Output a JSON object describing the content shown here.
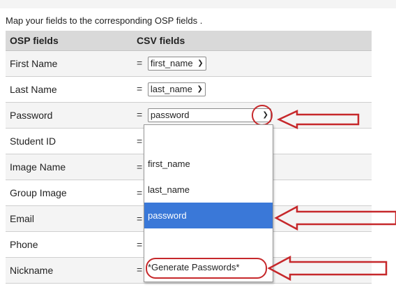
{
  "intro_text": "Map your fields to the corresponding OSP fields .",
  "headers": {
    "osp": "OSP fields",
    "csv": "CSV fields"
  },
  "rows": [
    {
      "label": "First Name",
      "value": "first_name"
    },
    {
      "label": "Last Name",
      "value": "last_name"
    },
    {
      "label": "Password",
      "value": "password"
    },
    {
      "label": "Student ID",
      "value": ""
    },
    {
      "label": "Image Name",
      "value": ""
    },
    {
      "label": "Group Image",
      "value": ""
    },
    {
      "label": "Email",
      "value": ""
    },
    {
      "label": "Phone",
      "value": ""
    },
    {
      "label": "Nickname",
      "value": ""
    }
  ],
  "equals": "=",
  "dropdown_options": [
    "",
    "first_name",
    "last_name",
    "password",
    "",
    "*Generate Passwords*"
  ],
  "dropdown_selected": "password",
  "accent_color": "#c6282b",
  "selected_color": "#3a78d8"
}
